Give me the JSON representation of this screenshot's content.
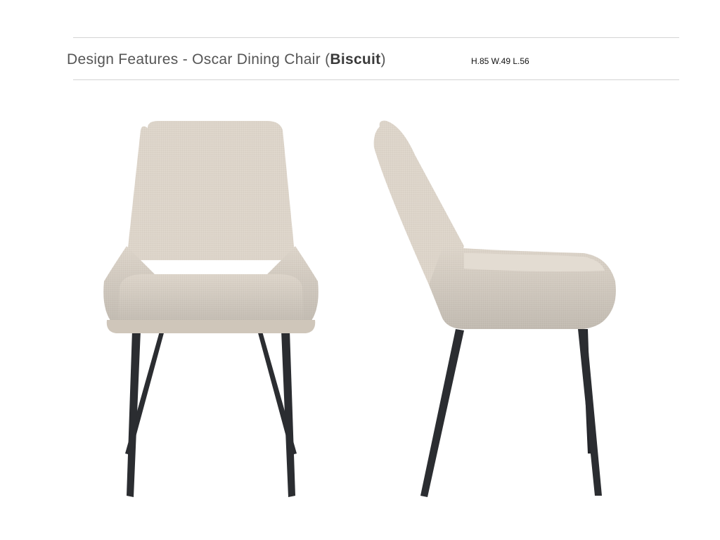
{
  "header": {
    "title_prefix": "Design Features - Oscar Dining Chair (",
    "title_emphasis": "Biscuit",
    "title_suffix": ")",
    "dimensions": "H.85 W.49 L.56"
  },
  "images": {
    "front": "chair-front-view",
    "side": "chair-side-view"
  },
  "colors": {
    "fabric": "#ddd5ca",
    "fabric_shadow": "#c9c0b4",
    "legs": "#2b2d31",
    "rule": "#d4d4d4"
  }
}
